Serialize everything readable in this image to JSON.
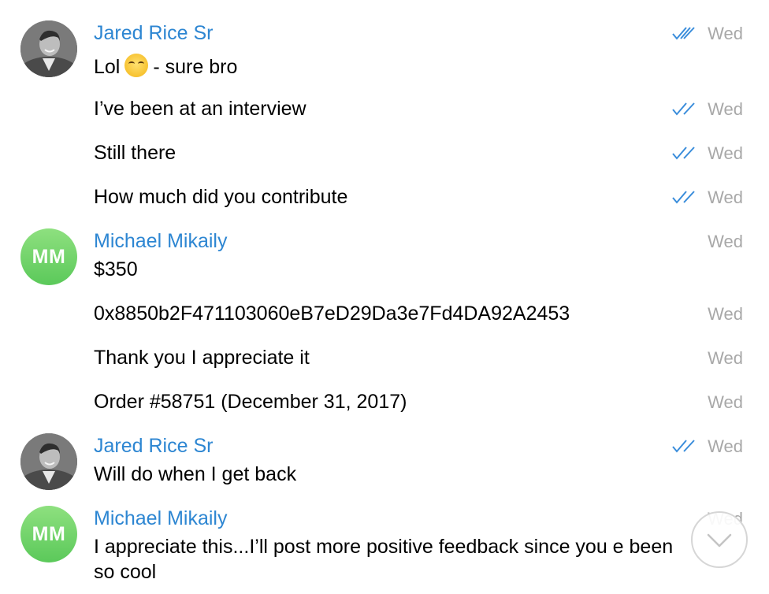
{
  "messages": [
    {
      "sender": "Jared Rice Sr",
      "text_before": "Lol",
      "text_after": "- sure bro",
      "emoji": "laugh-tears",
      "time": "Wed",
      "read": true
    },
    {
      "text": "I’ve been at an interview",
      "time": "Wed",
      "read": true
    },
    {
      "text": "Still there",
      "time": "Wed",
      "read": true
    },
    {
      "text": "How much did you contribute",
      "time": "Wed",
      "read": true
    },
    {
      "sender": "Michael Mikaily",
      "avatar_initials": "MM",
      "text": "$350",
      "time": "Wed",
      "read": false
    },
    {
      "text": "0x8850b2F471103060eB7eD29Da3e7Fd4DA92A2453",
      "time": "Wed",
      "read": false
    },
    {
      "text": "Thank you I appreciate it",
      "time": "Wed",
      "read": false
    },
    {
      "text": "Order #58751 (December 31, 2017)",
      "time": "Wed",
      "read": false
    },
    {
      "sender": "Jared Rice Sr",
      "text": "Will do when I get back",
      "time": "Wed",
      "read": true
    },
    {
      "sender": "Michael Mikaily",
      "avatar_initials": "MM",
      "text": "I appreciate this...I’ll post more positive feedback since you e been so cool",
      "time": "Wed",
      "read": false
    }
  ],
  "colors": {
    "sender": "#2d86d2",
    "check": "#3a8ddb",
    "time": "#a8a8a8",
    "avatar_green": "#5bc95a"
  },
  "icons": {
    "read": "double-check-icon",
    "scroll": "chevron-down-icon"
  }
}
